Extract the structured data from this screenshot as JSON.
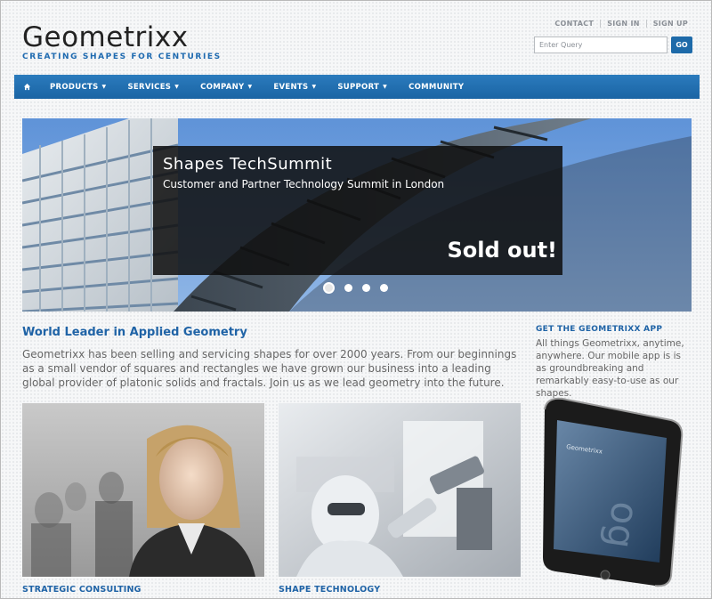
{
  "brand": {
    "name": "Geometrixx",
    "tagline": "CREATING SHAPES FOR CENTURIES"
  },
  "toplinks": [
    "CONTACT",
    "SIGN IN",
    "SIGN UP"
  ],
  "search": {
    "placeholder": "Enter Query",
    "button": "GO"
  },
  "nav": {
    "home_icon": "home-icon",
    "items": [
      {
        "label": "PRODUCTS",
        "dropdown": true
      },
      {
        "label": "SERVICES",
        "dropdown": true
      },
      {
        "label": "COMPANY",
        "dropdown": true
      },
      {
        "label": "EVENTS",
        "dropdown": true
      },
      {
        "label": "SUPPORT",
        "dropdown": true
      },
      {
        "label": "COMMUNITY",
        "dropdown": false
      }
    ]
  },
  "hero": {
    "title": "Shapes TechSummit",
    "subtitle": "Customer and Partner Technology Summit in London",
    "badge": "Sold out!",
    "slides": 4,
    "active_slide": 1
  },
  "intro": {
    "title": "World Leader in Applied Geometry",
    "text": "Geometrixx has been selling and servicing shapes for over 2000 years. From our beginnings as a small vendor of squares and rectangles we have grown our business into a leading global provider of platonic solids and fractals. Join us as we lead geometry into the future."
  },
  "app": {
    "title": "GET THE GEOMETRIXX APP",
    "text": "All things Geometrixx, anytime, anywhere. Our mobile app is is as groundbreaking and remarkably easy-to-use as our shapes.",
    "phone_screen_text": "Geometrixx"
  },
  "features": [
    {
      "caption": "STRATEGIC CONSULTING"
    },
    {
      "caption": "SHAPE TECHNOLOGY"
    }
  ],
  "colors": {
    "brand_blue": "#1f63a6",
    "nav_blue": "#1a64a4",
    "button_blue": "#1d6aa9"
  }
}
